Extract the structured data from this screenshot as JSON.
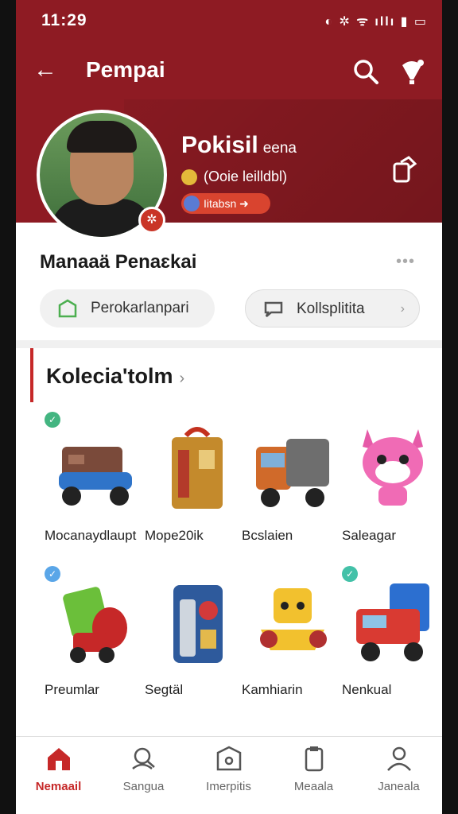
{
  "status_bar": {
    "time": "11:29",
    "icons": "◐ ✲ ᯤ ıllı ▮ ▭"
  },
  "app_bar": {
    "title": "Pempai",
    "back_icon": "arrow-left-icon",
    "search_icon": "search-icon",
    "bulb_icon": "lightbulb-icon"
  },
  "profile": {
    "name": "Pokisil",
    "name_suffix": "eena",
    "info": "(Ooie leilldbl)",
    "tag": "Iitabsn ➜",
    "accent": "#8e1b23"
  },
  "owner_section": {
    "title": "Manaaä Penaɛkai",
    "more": "•••"
  },
  "chips": [
    {
      "label": "Perokarlanpari",
      "icon": "bag-icon"
    },
    {
      "label": "Kollsplitita",
      "icon": "chat-icon",
      "arrow": "›"
    }
  ],
  "collection": {
    "title": "Kolecia'tolm",
    "chevron": "›",
    "items": [
      {
        "label": "Mocanaydlaupt",
        "check": "✓",
        "check_color": "#43b581",
        "toy": "vehicle"
      },
      {
        "label": "Mope20ik",
        "check": "",
        "toy": "machine"
      },
      {
        "label": "Bcslaien",
        "check": "",
        "toy": "truck"
      },
      {
        "label": "Saleagar",
        "check": "",
        "toy": "creature"
      },
      {
        "label": "Preumlar",
        "check": "✓",
        "check_color": "#5aa6e8",
        "toy": "robot"
      },
      {
        "label": "Segtäl",
        "check": "",
        "toy": "cabinet"
      },
      {
        "label": "Kamhiarin",
        "check": "",
        "toy": "car"
      },
      {
        "label": "Nenkual",
        "check": "✓",
        "check_color": "#43c1a8",
        "toy": "truck2"
      }
    ]
  },
  "bottom_nav": [
    {
      "label": "Nemaail",
      "icon": "home-icon",
      "active": true
    },
    {
      "label": "Sangua",
      "icon": "user-search-icon",
      "active": false
    },
    {
      "label": "Imerpitis",
      "icon": "store-icon",
      "active": false
    },
    {
      "label": "Meaala",
      "icon": "clipboard-icon",
      "active": false
    },
    {
      "label": "Janeala",
      "icon": "profile-icon",
      "active": false
    }
  ]
}
